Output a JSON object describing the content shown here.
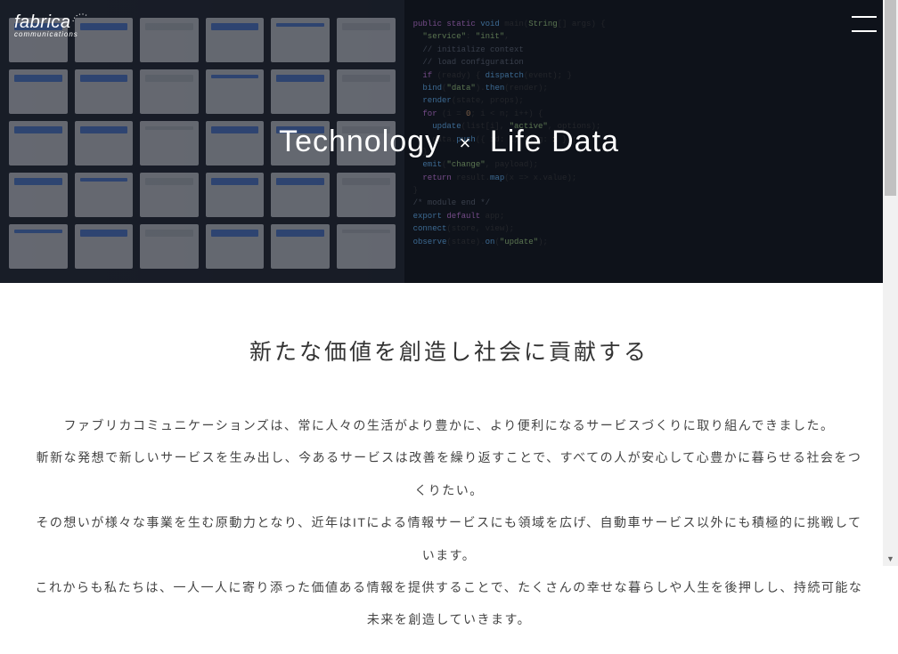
{
  "logo": {
    "main": "fabrica",
    "sub": "communications"
  },
  "hero": {
    "title_left": "Technology",
    "title_sep": "×",
    "title_right": "Life Data"
  },
  "section": {
    "heading": "新たな価値を創造し社会に貢献する",
    "p1": "ファブリカコミュニケーションズは、常に人々の生活がより豊かに、より便利になるサービスづくりに取り組んできました。",
    "p2": "斬新な発想で新しいサービスを生み出し、今あるサービスは改善を繰り返すことで、すべての人が安心して心豊かに暮らせる社会をつくりたい。",
    "p3": "その想いが様々な事業を生む原動力となり、近年はITによる情報サービスにも領域を広げ、自動車サービス以外にも積極的に挑戦しています。",
    "p4": "これからも私たちは、一人一人に寄り添った価値ある情報を提供することで、たくさんの幸せな暮らしや人生を後押しし、持続可能な未来を創造していきます。"
  }
}
